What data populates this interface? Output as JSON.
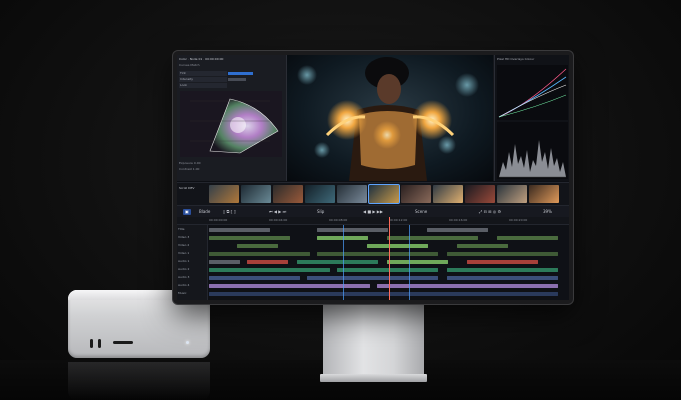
{
  "colors": {
    "video": "#4a6b3e",
    "video_hi": "#6fa85a",
    "audio": "#3b4f7a",
    "audio2": "#2c7a5a",
    "title": "#8b6fae",
    "grey": "#5a5e66",
    "red": "#a8403a",
    "accent": "#4da0ff"
  },
  "icons": [
    "gamut-scope-icon",
    "waveform-icon",
    "parade-icon",
    "play-icon",
    "lock-icon",
    "layers-icon"
  ],
  "color_panel": {
    "title": "Color · Node 01 · 00:00:00:00",
    "menu": "Curves   Match",
    "rows": [
      "Tint",
      "Intensity",
      "Look"
    ],
    "footer_a": "Exposure  0.00",
    "footer_b": "Contrast   1.00"
  },
  "scopes": {
    "head": "Pixel   HD   Overlays   Colour"
  },
  "strip": {
    "label": "Scroll   DEV"
  },
  "transport": {
    "tool_a": "Blade",
    "tool_b": "Slip",
    "scene": "Scene",
    "zoom": "39%",
    "tc_in": "00:00:00:00",
    "tc_center": "400 / 00:00:12:00",
    "tc_out": "400 / 00:00:48:00"
  },
  "ruler": [
    "00:00:00:00",
    "00:00:04:00",
    "00:00:08:00",
    "00:00:12:00",
    "00:00:16:00",
    "00:00:20:00"
  ],
  "tracks": [
    "Title",
    "Video 3",
    "Video 2",
    "Video 1",
    "Audio 1",
    "Audio 2",
    "Audio 3",
    "Audio 4",
    "Music"
  ]
}
